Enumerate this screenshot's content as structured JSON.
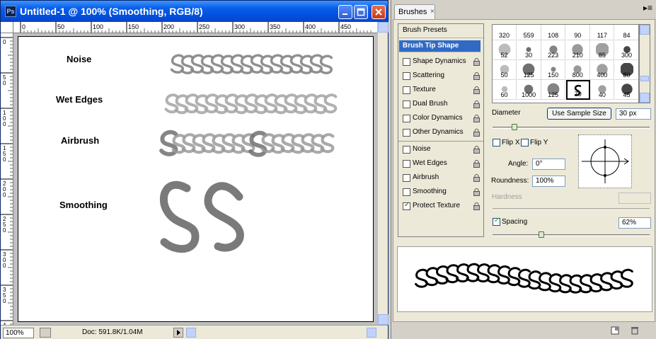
{
  "document": {
    "title": "Untitled-1 @ 100% (Smoothing, RGB/8)",
    "app_icon": "Ps",
    "ruler_top_labels": [
      "0",
      "50",
      "100",
      "150",
      "200",
      "250",
      "300",
      "350",
      "400",
      "450"
    ],
    "ruler_left_labels": [
      "0",
      "5 0",
      "1 0 0",
      "1 5 0",
      "2 0 0",
      "2 5 0",
      "3 0 0",
      "3 5 0",
      "4"
    ],
    "canvas_labels": {
      "noise": "Noise",
      "wet_edges": "Wet Edges",
      "airbrush": "Airbrush",
      "smoothing": "Smoothing"
    },
    "status": {
      "zoom": "100%",
      "doc_size": "Doc: 591.8K/1.04M"
    }
  },
  "brushes_panel": {
    "tab_label": "Brushes",
    "tab_close": "×",
    "menu_icon": "▸≡",
    "options_header": "Brush Presets",
    "selected_option": "Brush Tip Shape",
    "options": [
      {
        "label": "Shape Dynamics",
        "checked": false
      },
      {
        "label": "Scattering",
        "checked": false
      },
      {
        "label": "Texture",
        "checked": false
      },
      {
        "label": "Dual Brush",
        "checked": false
      },
      {
        "label": "Color Dynamics",
        "checked": false
      },
      {
        "label": "Other Dynamics",
        "checked": false
      },
      {
        "label": "Noise",
        "checked": false
      },
      {
        "label": "Wet Edges",
        "checked": false
      },
      {
        "label": "Airbrush",
        "checked": false
      },
      {
        "label": "Smoothing",
        "checked": false
      },
      {
        "label": "Protect Texture",
        "checked": true
      }
    ],
    "presets": [
      [
        "320",
        "559",
        "108",
        "90",
        "117",
        "84"
      ],
      [
        "52",
        "30",
        "223",
        "210",
        "85",
        "300"
      ],
      [
        "50",
        "125",
        "150",
        "800",
        "400",
        "80"
      ],
      [
        "60",
        "1000",
        "125",
        "70",
        "40",
        "45"
      ]
    ],
    "selected_preset": "70",
    "diameter_label": "Diameter",
    "use_sample_size": "Use Sample Size",
    "diameter_value": "30 px",
    "diameter_fraction": 0.14,
    "flip_x": "Flip X",
    "flip_y": "Flip Y",
    "angle_label": "Angle:",
    "angle_value": "0°",
    "roundness_label": "Roundness:",
    "roundness_value": "100%",
    "hardness_label": "Hardness",
    "spacing_label": "Spacing",
    "spacing_checked": true,
    "spacing_value": "62%",
    "spacing_fraction": 0.31
  },
  "colors": {
    "title_gradient_top": "#3d95ff",
    "title_gradient_bottom": "#0a44c6",
    "selection": "#316ac5",
    "stroke_gray": "#808080",
    "stroke_light": "#a8a8a8"
  }
}
